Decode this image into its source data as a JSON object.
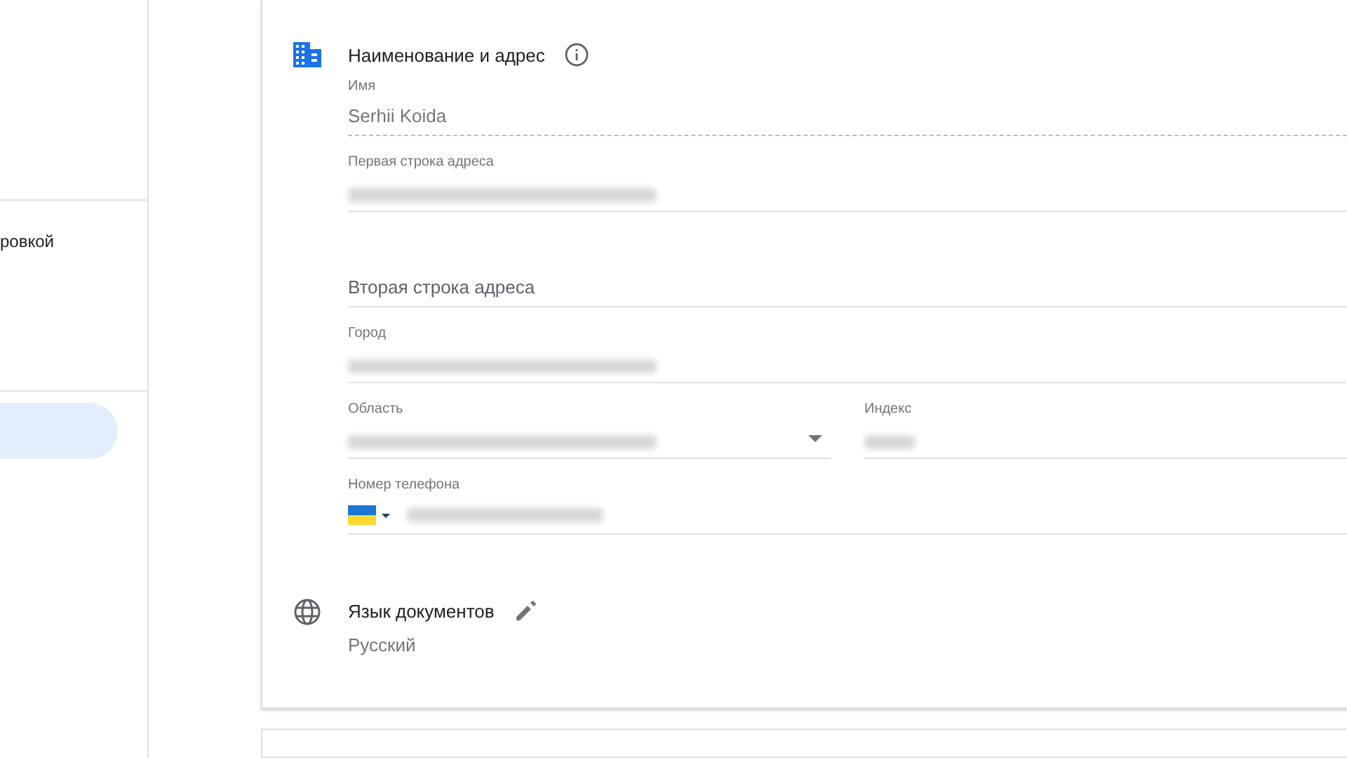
{
  "sidebar": {
    "items": [
      {
        "label": "ровкой",
        "selected": false
      },
      {
        "selected": true
      }
    ]
  },
  "address_section": {
    "title": "Наименование и адрес",
    "fields": [
      {
        "kind": "text",
        "label": "Имя",
        "value": "Serhii Koida",
        "disabled": true
      },
      {
        "kind": "text",
        "label": "Первая строка адреса",
        "redacted": true
      },
      {
        "kind": "text",
        "placeholder": "Вторая строка адреса"
      },
      {
        "kind": "text",
        "label": "Город",
        "redacted": true
      },
      {
        "kind": "select_pair",
        "label": "Область",
        "redacted": true,
        "second": {
          "label": "Индекс",
          "redacted": true
        }
      },
      {
        "kind": "phone",
        "label": "Номер телефона",
        "redacted": true
      }
    ]
  },
  "language_section": {
    "title": "Язык документов",
    "value": "Русский"
  }
}
